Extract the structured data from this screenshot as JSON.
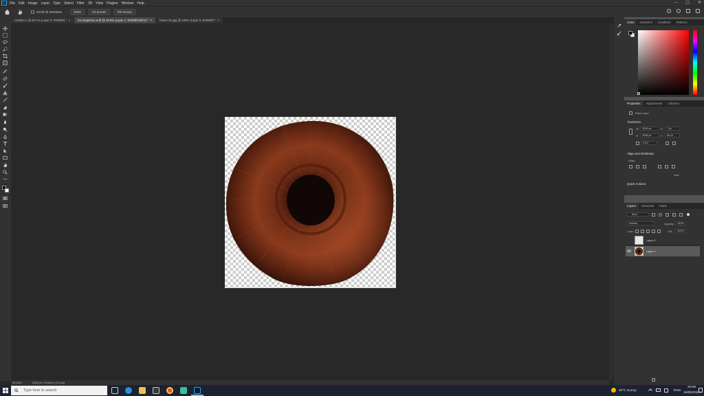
{
  "menubar": {
    "app_icon": "Ps",
    "items": [
      "File",
      "Edit",
      "Image",
      "Layer",
      "Type",
      "Select",
      "Filter",
      "3D",
      "View",
      "Plugins",
      "Window",
      "Help"
    ],
    "window_controls": [
      "–",
      "▢",
      "✕"
    ]
  },
  "options_bar": {
    "scroll_all_windows": "Scroll All Windows",
    "zoom": "100%",
    "fit_screen": "Fit Screen",
    "fill_screen": "Fill Screen"
  },
  "tabs": [
    {
      "label": "Untitled-1 @ 66.7% (Layer 0, RGB/8#) *",
      "active": false
    },
    {
      "label": "iris snapshot uv.tif @ 45.5% (Layer 1, RGB/8/CMYK) *",
      "active": true
    },
    {
      "label": "brown iris.jpg @ 100% (Layer 0, RGB/8#) *",
      "active": false
    }
  ],
  "status": {
    "zoom": "96.53%",
    "doc_info": "2048 px x 2048 px (72 ppi)"
  },
  "color_panel": {
    "tabs": [
      "Color",
      "Swatches",
      "Gradients",
      "Patterns"
    ],
    "accent_color": "#ff0000"
  },
  "properties_panel": {
    "tabs": [
      "Properties",
      "Adjustments",
      "Libraries"
    ],
    "layer_type": "Pixel Layer",
    "transform_title": "Transform",
    "w_label": "W",
    "w_value": "2048 px",
    "x_label": "X",
    "x_value": "7 px",
    "h_label": "H",
    "h_value": "2048 px",
    "y_label": "Y",
    "y_value": "50 px",
    "angle_value": "0.00°",
    "align_title": "Align and Distribute",
    "align_label": "Align:",
    "quick_actions_title": "Quick Actions"
  },
  "layers_panel": {
    "tabs": [
      "Layers",
      "Channels",
      "Paths"
    ],
    "filter": "Kind",
    "blend_mode": "Normal",
    "opacity_label": "Opacity:",
    "opacity_value": "100%",
    "lock_label": "Lock:",
    "fill_label": "Fill:",
    "fill_value": "100%",
    "layers": [
      {
        "name": "Layer 0",
        "visible": false,
        "selected": false
      },
      {
        "name": "Layer 1",
        "visible": true,
        "selected": true
      }
    ]
  },
  "taskbar": {
    "search_placeholder": "Type here to search",
    "weather": "20°C  Sunny",
    "language": "ENG",
    "time": "20:09",
    "date": "19/05/2022"
  }
}
